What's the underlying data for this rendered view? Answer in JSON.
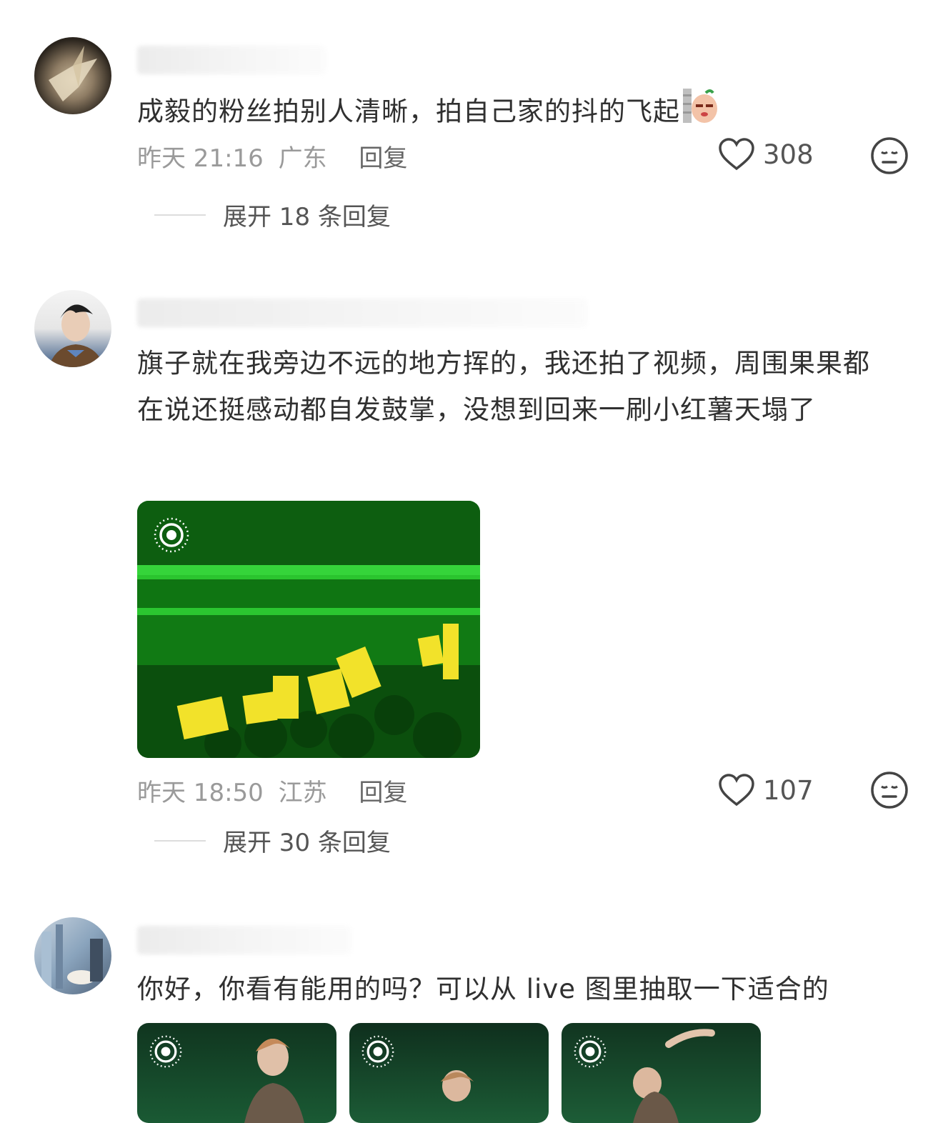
{
  "comments": [
    {
      "text": "成毅的粉丝拍别人清晰，拍自己家的抖的飞起",
      "time": "昨天 21:16",
      "location": "广东",
      "reply_label": "回复",
      "likes": "308",
      "expand_label": "展开 18 条回复"
    },
    {
      "text": "旗子就在我旁边不远的地方挥的，我还拍了视频，周围果果都在说还挺感动都自发鼓掌，没想到回来一刷小红薯天塌了",
      "time": "昨天 18:50",
      "location": "江苏",
      "reply_label": "回复",
      "likes": "107",
      "expand_label": "展开 30 条回复"
    },
    {
      "text": "你好，你看有能用的吗？可以从 live 图里抽取一下适合的"
    }
  ],
  "icons": {
    "like": "heart-outline-icon",
    "dislike": "neutral-face-icon",
    "live_photo": "live-photo-icon",
    "emoji": "peeking-potato-emoji-icon"
  },
  "colors": {
    "text": "#303030",
    "meta": "#9a9a9a",
    "photo_green": "#1fb824",
    "flag_yellow": "#f2e22a"
  }
}
